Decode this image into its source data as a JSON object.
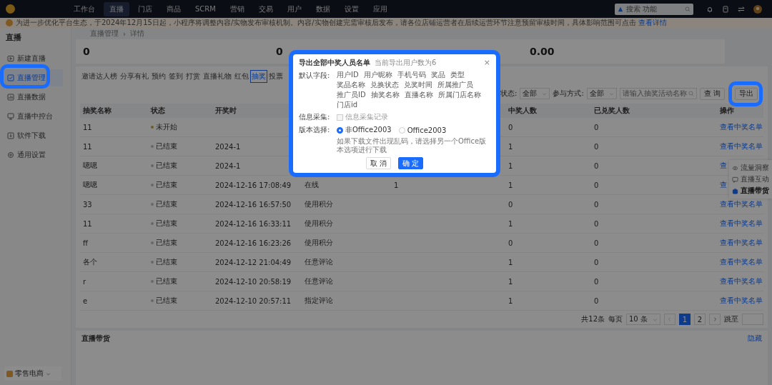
{
  "top_nav": {
    "items": [
      {
        "label": "工作台",
        "selected": false
      },
      {
        "label": "直播",
        "selected": true
      },
      {
        "label": "门店",
        "selected": false
      },
      {
        "label": "商品",
        "selected": false
      },
      {
        "label": "SCRM",
        "selected": false
      },
      {
        "label": "营销",
        "selected": false
      },
      {
        "label": "交易",
        "selected": false
      },
      {
        "label": "用户",
        "selected": false
      },
      {
        "label": "数据",
        "selected": false
      },
      {
        "label": "设置",
        "selected": false
      },
      {
        "label": "应用",
        "selected": false
      }
    ],
    "search": {
      "placeholder": "搜索 功能"
    }
  },
  "notice": {
    "text": "为进一步优化平台生态，于2024年12月15日起，小程序将调整内容/实物发布审核机制。内容/实物创建完需审核后发布，请各位店铺运营者在后续运营环节注意预留审核时间，具体影响范围可点击",
    "link": "查看详情"
  },
  "sidebar": {
    "title": "直播",
    "items": [
      {
        "label": "新建直播",
        "selected": false,
        "highlighted": false
      },
      {
        "label": "直播管理",
        "selected": true,
        "highlighted": true
      },
      {
        "label": "直播数据",
        "selected": false,
        "highlighted": false
      },
      {
        "label": "直播中控台",
        "selected": false,
        "highlighted": false
      },
      {
        "label": "软件下载",
        "selected": false,
        "highlighted": false
      },
      {
        "label": "通用设置",
        "selected": false,
        "highlighted": false
      }
    ],
    "footer": "零售电商"
  },
  "breadcrumb": {
    "items": [
      "直播管理",
      "详情"
    ],
    "separator": "›"
  },
  "stats": [
    "0",
    "0",
    "0.00"
  ],
  "tabs": [
    {
      "label": "邀请达人榜",
      "selected": false
    },
    {
      "label": "分享有礼",
      "selected": false
    },
    {
      "label": "预约",
      "selected": false
    },
    {
      "label": "签到",
      "selected": false
    },
    {
      "label": "打赏",
      "selected": false
    },
    {
      "label": "直播礼物",
      "selected": false
    },
    {
      "label": "红包",
      "selected": false
    },
    {
      "label": "抽奖",
      "selected": true
    },
    {
      "label": "投票",
      "selected": false
    }
  ],
  "filters": {
    "status_label": "状态:",
    "status_value": "全部",
    "mode_label": "参与方式:",
    "mode_value": "全部",
    "search_placeholder": "请输入抽奖活动名称",
    "query_button": "查 询",
    "export_button": {
      "label": "导出",
      "highlighted": true
    }
  },
  "table": {
    "columns": [
      {
        "label": "抽奖名称"
      },
      {
        "label": "状态"
      },
      {
        "label": "开奖时"
      },
      {},
      {},
      {
        "label": "中奖人数"
      },
      {
        "label": "已兑奖人数"
      },
      {
        "label": "操作"
      }
    ],
    "rows": [
      {
        "name": "11",
        "status": "未开始",
        "winners": "0",
        "redeemed": "0",
        "action": "查看中奖名单"
      },
      {
        "name": "11",
        "status": "已结束",
        "time": "2024-1",
        "winners": "1",
        "redeemed": "0",
        "action": "查看中奖名单"
      },
      {
        "name": "嗯嗯",
        "status": "已结束",
        "time": "2024-1",
        "winners": "1",
        "redeemed": "0",
        "action": "查"
      },
      {
        "name": "嗯嗯",
        "status": "已结束",
        "time": "2024-12-16 17:08:49",
        "mode": "在线",
        "column_5": "1",
        "winners": "1",
        "redeemed": "0",
        "action": "查"
      },
      {
        "name": "33",
        "status": "已结束",
        "time": "2024-12-16 16:57:50",
        "mode": "使用积分",
        "winners": "0",
        "redeemed": "0",
        "action": "查看中奖名单"
      },
      {
        "name": "11",
        "status": "已结束",
        "time": "2024-12-16 16:33:11",
        "mode": "使用积分",
        "winners": "1",
        "redeemed": "0",
        "action": "查看中奖名单"
      },
      {
        "name": "ff",
        "status": "已结束",
        "time": "2024-12-16 16:23:26",
        "mode": "使用积分",
        "winners": "0",
        "redeemed": "0",
        "action": "查看中奖名单"
      },
      {
        "name": "各个",
        "status": "已结束",
        "time": "2024-12-12 21:04:49",
        "mode": "任意评论",
        "winners": "1",
        "redeemed": "0",
        "action": "查看中奖名单"
      },
      {
        "name": "r",
        "status": "已结束",
        "time": "2024-12-10 20:58:19",
        "mode": "任意评论",
        "winners": "1",
        "redeemed": "0",
        "action": "查看中奖名单"
      },
      {
        "name": "e",
        "status": "已结束",
        "time": "2024-12-10 20:57:11",
        "mode": "指定评论",
        "winners": "1",
        "redeemed": "0",
        "action": "查看中奖名单"
      }
    ]
  },
  "pagination": {
    "total": "共12条",
    "per_page_label": "每页",
    "per_page": "10 条",
    "pages": [
      {
        "label": "1",
        "selected": true
      },
      {
        "label": "2",
        "selected": false
      }
    ],
    "jump_label": "跳至"
  },
  "side_panel": [
    {
      "label": "流量洞察",
      "selected": false
    },
    {
      "label": "直播互动",
      "selected": false
    },
    {
      "label": "直播带货",
      "selected": true
    }
  ],
  "bottom_section": {
    "title": "直播带货",
    "action": "隐藏"
  },
  "modal": {
    "title": "导出全部中奖人员名单",
    "subtitle": "当前导出用户数为6",
    "close": "×",
    "highlighted": true,
    "fields_label": "默认字段:",
    "fields": [
      "用户ID",
      "用户昵称",
      "手机号码",
      "奖品",
      "类型",
      "奖品名称",
      "兑换状态",
      "兑奖时间",
      "所属推广员",
      "推广员ID",
      "抽奖名称",
      "直播名称",
      "所属门店名称",
      "门店id"
    ],
    "collect_label": "信息采集:",
    "collect_option": {
      "label": "信息采集记录",
      "checked": false,
      "disabled": true
    },
    "version_label": "版本选择:",
    "versions": [
      {
        "label": "非Office2003",
        "selected": true
      },
      {
        "label": "Office2003",
        "selected": false
      }
    ],
    "hint": "如果下载文件出现乱码，请选择另一个Office版本选项进行下载",
    "cancel": "取 消",
    "confirm": "确 定"
  }
}
